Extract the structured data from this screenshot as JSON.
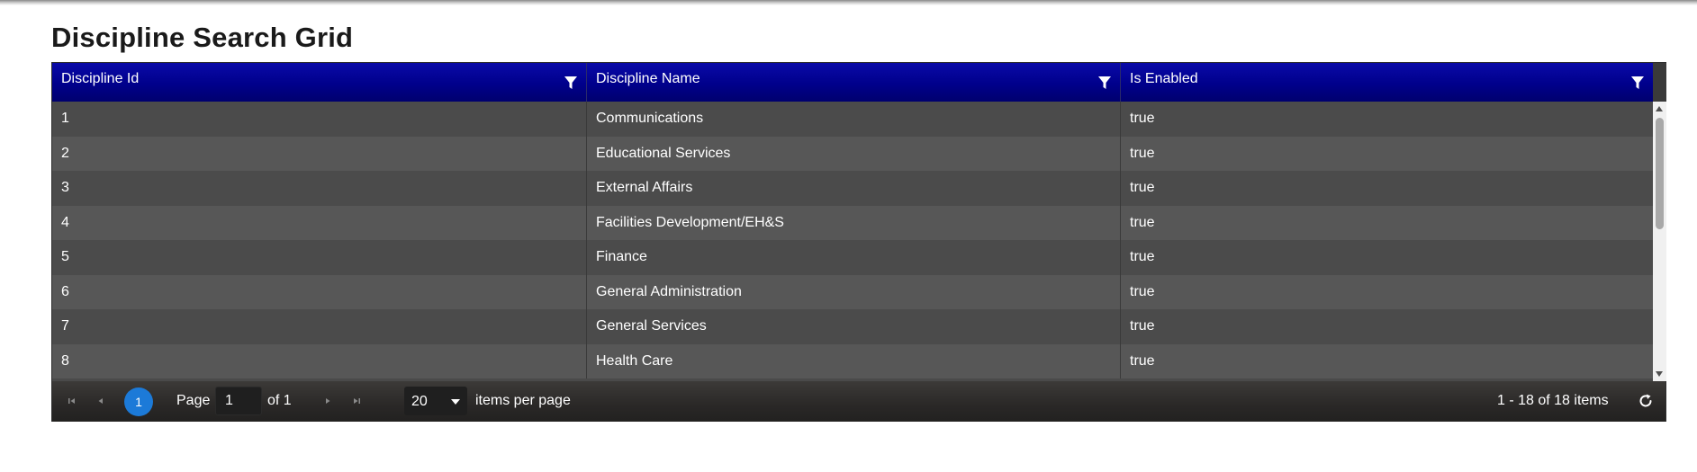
{
  "page": {
    "title": "Discipline Search Grid"
  },
  "grid": {
    "columns": [
      {
        "label": "Discipline Id"
      },
      {
        "label": "Discipline Name"
      },
      {
        "label": "Is Enabled"
      }
    ],
    "rows": [
      {
        "id": "1",
        "name": "Communications",
        "enabled": "true"
      },
      {
        "id": "2",
        "name": "Educational Services",
        "enabled": "true"
      },
      {
        "id": "3",
        "name": "External Affairs",
        "enabled": "true"
      },
      {
        "id": "4",
        "name": "Facilities Development/EH&S",
        "enabled": "true"
      },
      {
        "id": "5",
        "name": "Finance",
        "enabled": "true"
      },
      {
        "id": "6",
        "name": "General Administration",
        "enabled": "true"
      },
      {
        "id": "7",
        "name": "General Services",
        "enabled": "true"
      },
      {
        "id": "8",
        "name": "Health Care",
        "enabled": "true"
      }
    ]
  },
  "pager": {
    "current_page": "1",
    "page_label": "Page",
    "page_input_value": "1",
    "of_label": "of 1",
    "page_size": "20",
    "items_per_page_label": "items per page",
    "summary": "1 - 18 of 18 items"
  },
  "colors": {
    "header_bg": "#00008b",
    "accent": "#1c7ad8",
    "row_odd": "#4b4b4b",
    "row_even": "#575757"
  },
  "icons": {
    "filter": "filter-icon",
    "first": "first-page-icon",
    "prev": "previous-page-icon",
    "next": "next-page-icon",
    "last": "last-page-icon",
    "refresh": "refresh-icon"
  }
}
